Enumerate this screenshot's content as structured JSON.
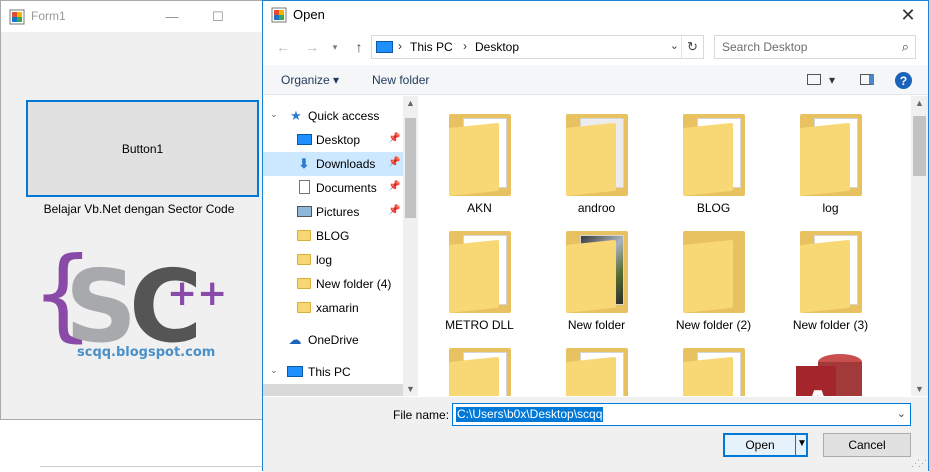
{
  "form1": {
    "title": "Form1",
    "button_label": "Button1",
    "label": "Belajar Vb.Net dengan Sector Code",
    "logo_text": "SC",
    "logo_plus": "++",
    "logo_url": "scqq.blogspot.com"
  },
  "dialog": {
    "title": "Open",
    "breadcrumb": [
      "This PC",
      "Desktop"
    ],
    "search_placeholder": "Search Desktop",
    "toolbar": {
      "organize": "Organize",
      "new_folder": "New folder"
    },
    "nav_items": [
      {
        "label": "Quick access",
        "icon": "star-icon"
      },
      {
        "label": "Desktop",
        "icon": "desktop-icon",
        "pinned": true
      },
      {
        "label": "Downloads",
        "icon": "download-icon",
        "pinned": true,
        "selected": true
      },
      {
        "label": "Documents",
        "icon": "documents-icon",
        "pinned": true
      },
      {
        "label": "Pictures",
        "icon": "pictures-icon",
        "pinned": true
      },
      {
        "label": "BLOG",
        "icon": "folder-icon"
      },
      {
        "label": "log",
        "icon": "folder-icon"
      },
      {
        "label": "New folder (4)",
        "icon": "folder-icon"
      },
      {
        "label": "xamarin",
        "icon": "folder-icon"
      },
      {
        "label": "OneDrive",
        "icon": "cloud-icon"
      },
      {
        "label": "This PC",
        "icon": "pc-icon"
      }
    ],
    "files": [
      {
        "name": "AKN",
        "kind": "folder"
      },
      {
        "name": "androo",
        "kind": "folder"
      },
      {
        "name": "BLOG",
        "kind": "folder"
      },
      {
        "name": "log",
        "kind": "folder"
      },
      {
        "name": "METRO DLL",
        "kind": "folder"
      },
      {
        "name": "New folder",
        "kind": "folder"
      },
      {
        "name": "New folder (2)",
        "kind": "folder"
      },
      {
        "name": "New folder (3)",
        "kind": "folder"
      },
      {
        "name": "",
        "kind": "folder"
      },
      {
        "name": "",
        "kind": "folder"
      },
      {
        "name": "",
        "kind": "folder"
      },
      {
        "name": "",
        "kind": "access-file"
      }
    ],
    "file_name_label": "File name:",
    "file_name_value": "C:\\Users\\b0x\\Desktop\\scqq",
    "open_label": "Open",
    "cancel_label": "Cancel"
  },
  "colors": {
    "accent": "#0078d7",
    "selection": "#cce8ff",
    "folder": "#f8d775",
    "logo_purple": "#8a4ba8",
    "logo_gray": "#a7a9ac",
    "logo_dark": "#555555"
  }
}
